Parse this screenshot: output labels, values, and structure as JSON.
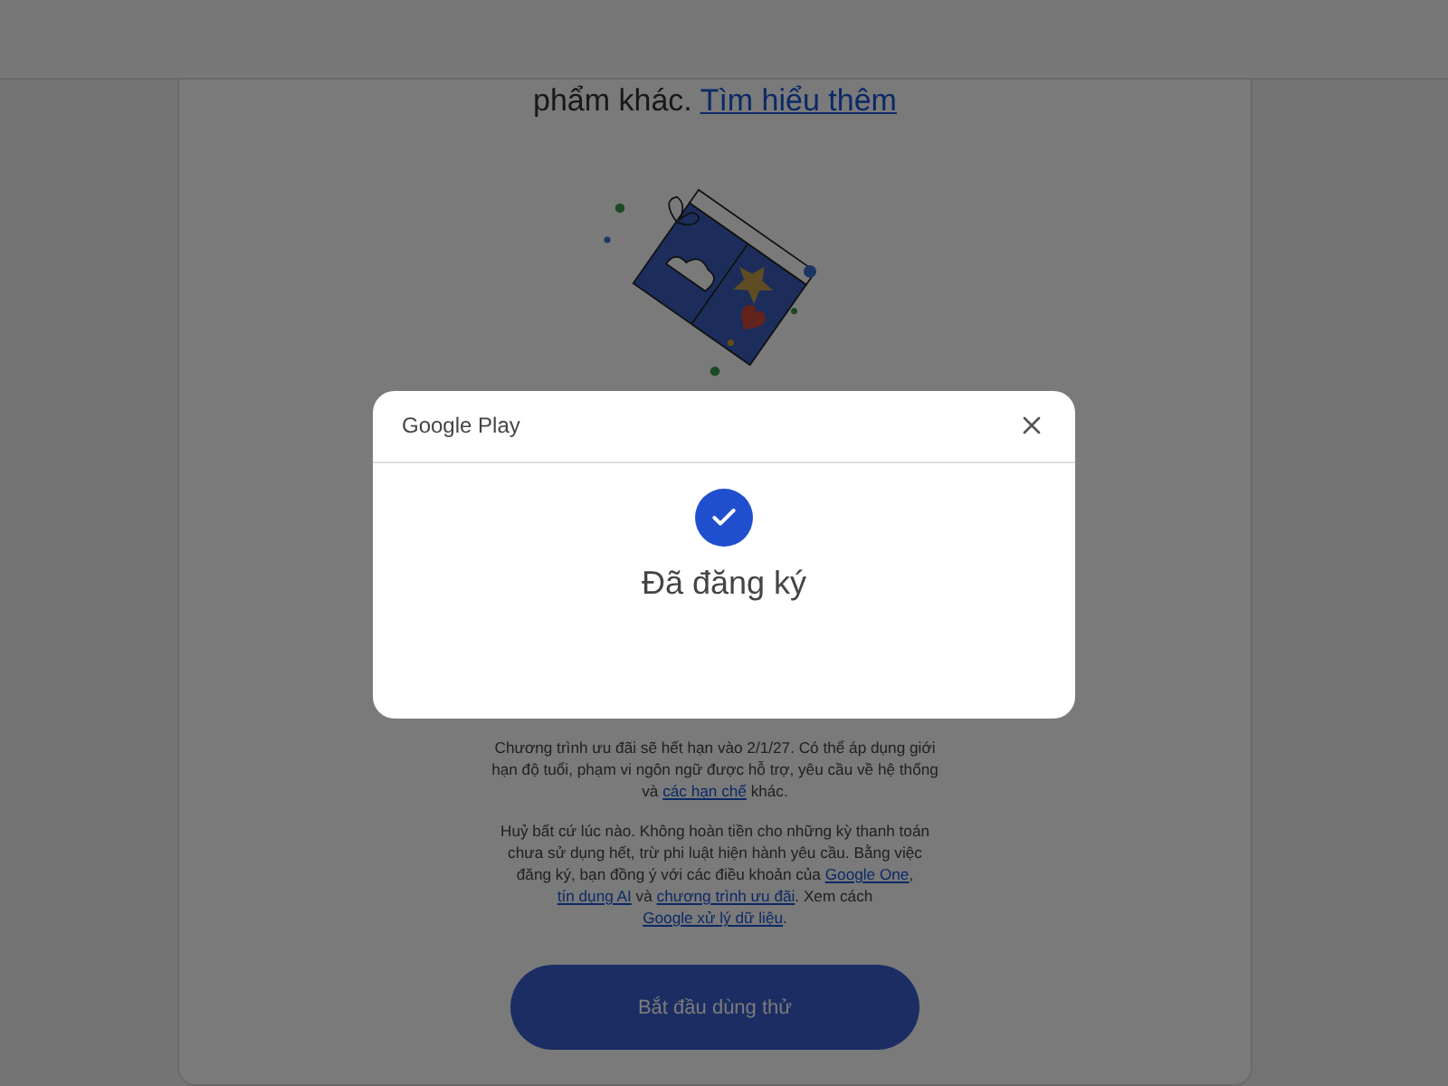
{
  "page": {
    "intro": [
      {
        "text": "phẩm khác. ",
        "kind": "text"
      },
      {
        "text": "Tìm hiểu thêm",
        "kind": "link"
      }
    ],
    "terms": [
      [
        {
          "text": "Chương trình ưu đãi sẽ hết hạn vào 2/1/27. Có thể áp dụng giới hạn độ tuổi, phạm vi ngôn ngữ được hỗ trợ, yêu cầu về hệ thống và ",
          "kind": "text"
        },
        {
          "text": "các hạn chế",
          "kind": "link"
        },
        {
          "text": " khác.",
          "kind": "text"
        }
      ],
      [
        {
          "text": "Huỷ bất cứ lúc nào. Không hoàn tiền cho những kỳ thanh toán chưa sử dụng hết, trừ phi luật hiện hành yêu cầu. Bằng việc đăng ký, bạn đồng ý với các điều khoản của ",
          "kind": "text"
        },
        {
          "text": "Google One",
          "kind": "link"
        },
        {
          "text": ", ",
          "kind": "text"
        },
        {
          "text": "tín dụng AI",
          "kind": "link"
        },
        {
          "text": " và ",
          "kind": "text"
        },
        {
          "text": "chương trình ưu đãi",
          "kind": "link"
        },
        {
          "text": ". Xem cách ",
          "kind": "text"
        },
        {
          "text": "Google xử lý dữ liệu",
          "kind": "link"
        },
        {
          "text": ".",
          "kind": "text"
        }
      ]
    ],
    "button": "Bắt đầu dùng thử"
  },
  "dialog": {
    "brand": "Google Play",
    "message": "Đã đăng ký"
  }
}
